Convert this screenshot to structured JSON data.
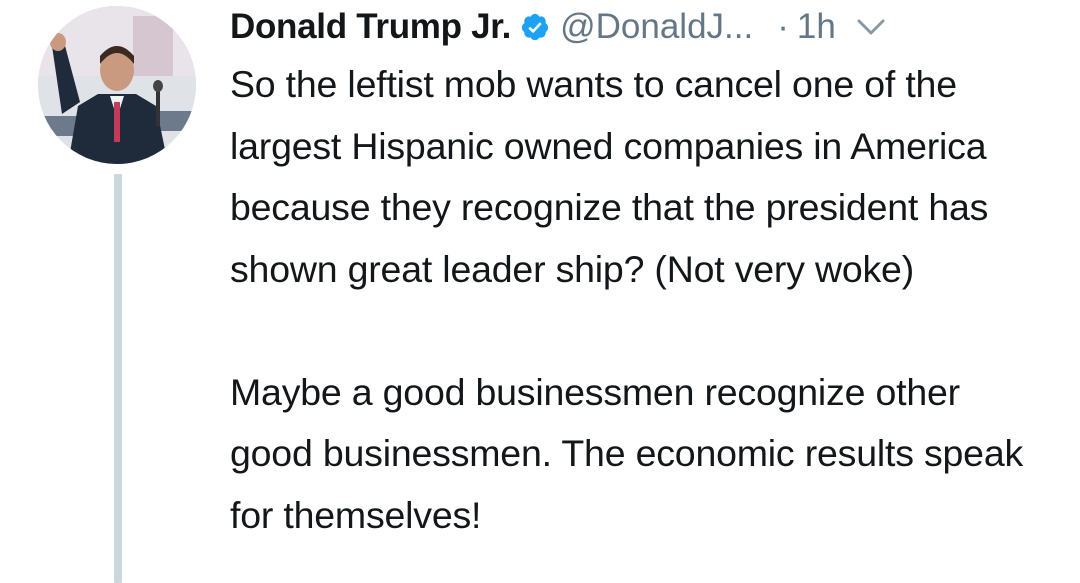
{
  "tweet": {
    "author": {
      "display_name": "Donald Trump Jr.",
      "handle": "@DonaldJ...",
      "verified": true
    },
    "separator": "·",
    "time": "1h",
    "icons": {
      "verified": "verified-badge-icon",
      "menu": "chevron-down-icon"
    },
    "colors": {
      "verified_badge": "#1da1f2",
      "secondary_text": "#657786",
      "thread_line": "#ccd6dd"
    },
    "paragraphs": [
      "So the leftist mob wants to cancel one of the largest Hispanic owned companies in America because they recognize that the president has shown great leader ship? (Not very woke)",
      "Maybe a good businessmen recognize other good businessmen. The economic results speak for themselves!"
    ]
  }
}
